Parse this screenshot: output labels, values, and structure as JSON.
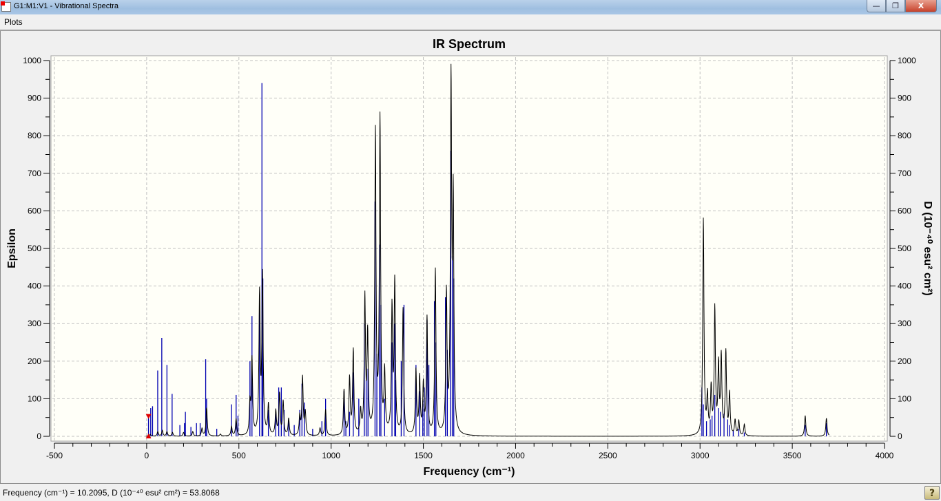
{
  "window": {
    "title": "G1:M1:V1 - Vibrational Spectra",
    "minimize": "—",
    "restore": "❐",
    "close": "X"
  },
  "menu": {
    "items": [
      {
        "label": "Plots"
      }
    ]
  },
  "status": {
    "text": "Frequency (cm⁻¹) = 10.2095, D (10⁻⁴⁰ esu² cm²) = 53.8068",
    "help": "?"
  },
  "colors": {
    "curve": "#000000",
    "sticks": "#0000b0",
    "plot_bg": "#fffff8",
    "grid": "#c0c0c0",
    "marker": "#e00000"
  },
  "chart_data": {
    "type": "line",
    "title": "IR Spectrum",
    "xlabel": "Frequency (cm⁻¹)",
    "ylabel": "Epsilon",
    "y2label": "D (10⁻⁴⁰ esu² cm²)",
    "xlim": [
      -500,
      4000
    ],
    "ylim": [
      0,
      1000
    ],
    "y2lim": [
      0,
      1000
    ],
    "grid": true,
    "xticks": [
      -500,
      0,
      500,
      1000,
      1500,
      2000,
      2500,
      3000,
      3500,
      4000
    ],
    "yticks": [
      0,
      100,
      200,
      300,
      400,
      500,
      600,
      700,
      800,
      900,
      1000
    ],
    "cursor": {
      "frequency": 10.2095,
      "D": 53.8068
    },
    "series": [
      {
        "name": "Epsilon (spectrum)",
        "axis": "left",
        "lineshape_hwhm": 4,
        "peaks": [
          [
            20,
            5
          ],
          [
            60,
            12
          ],
          [
            85,
            15
          ],
          [
            110,
            12
          ],
          [
            140,
            10
          ],
          [
            200,
            10
          ],
          [
            250,
            12
          ],
          [
            300,
            20
          ],
          [
            325,
            75
          ],
          [
            400,
            5
          ],
          [
            460,
            25
          ],
          [
            485,
            45
          ],
          [
            560,
            80
          ],
          [
            571,
            200
          ],
          [
            612,
            370
          ],
          [
            628,
            420
          ],
          [
            660,
            80
          ],
          [
            700,
            65
          ],
          [
            720,
            110
          ],
          [
            740,
            90
          ],
          [
            770,
            45
          ],
          [
            830,
            50
          ],
          [
            845,
            155
          ],
          [
            860,
            60
          ],
          [
            940,
            20
          ],
          [
            970,
            70
          ],
          [
            1070,
            120
          ],
          [
            1100,
            150
          ],
          [
            1120,
            225
          ],
          [
            1160,
            60
          ],
          [
            1183,
            360
          ],
          [
            1198,
            260
          ],
          [
            1240,
            800
          ],
          [
            1265,
            835
          ],
          [
            1290,
            160
          ],
          [
            1330,
            330
          ],
          [
            1345,
            400
          ],
          [
            1390,
            335
          ],
          [
            1460,
            170
          ],
          [
            1480,
            150
          ],
          [
            1500,
            130
          ],
          [
            1520,
            310
          ],
          [
            1565,
            440
          ],
          [
            1625,
            370
          ],
          [
            1650,
            920
          ],
          [
            1662,
            600
          ],
          [
            3018,
            575
          ],
          [
            3040,
            100
          ],
          [
            3060,
            120
          ],
          [
            3080,
            335
          ],
          [
            3100,
            180
          ],
          [
            3115,
            205
          ],
          [
            3140,
            220
          ],
          [
            3160,
            110
          ],
          [
            3190,
            40
          ],
          [
            3210,
            40
          ],
          [
            3240,
            30
          ],
          [
            3570,
            55
          ],
          [
            3685,
            48
          ]
        ]
      },
      {
        "name": "D (sticks)",
        "axis": "right",
        "sticks": [
          [
            10,
            54
          ],
          [
            22,
            75
          ],
          [
            32,
            80
          ],
          [
            60,
            175
          ],
          [
            82,
            262
          ],
          [
            110,
            190
          ],
          [
            138,
            113
          ],
          [
            180,
            30
          ],
          [
            205,
            35
          ],
          [
            210,
            65
          ],
          [
            240,
            25
          ],
          [
            270,
            35
          ],
          [
            290,
            35
          ],
          [
            320,
            205
          ],
          [
            325,
            100
          ],
          [
            380,
            20
          ],
          [
            460,
            85
          ],
          [
            485,
            110
          ],
          [
            495,
            55
          ],
          [
            560,
            200
          ],
          [
            571,
            320
          ],
          [
            612,
            375
          ],
          [
            625,
            940
          ],
          [
            630,
            420
          ],
          [
            660,
            70
          ],
          [
            700,
            60
          ],
          [
            716,
            130
          ],
          [
            730,
            130
          ],
          [
            745,
            70
          ],
          [
            770,
            40
          ],
          [
            800,
            30
          ],
          [
            830,
            70
          ],
          [
            842,
            140
          ],
          [
            855,
            90
          ],
          [
            900,
            20
          ],
          [
            950,
            40
          ],
          [
            970,
            100
          ],
          [
            1070,
            120
          ],
          [
            1080,
            40
          ],
          [
            1100,
            65
          ],
          [
            1120,
            170
          ],
          [
            1150,
            100
          ],
          [
            1180,
            300
          ],
          [
            1190,
            150
          ],
          [
            1200,
            180
          ],
          [
            1238,
            625
          ],
          [
            1248,
            220
          ],
          [
            1262,
            510
          ],
          [
            1270,
            350
          ],
          [
            1290,
            100
          ],
          [
            1330,
            250
          ],
          [
            1345,
            300
          ],
          [
            1350,
            150
          ],
          [
            1380,
            200
          ],
          [
            1395,
            350
          ],
          [
            1460,
            190
          ],
          [
            1480,
            120
          ],
          [
            1497,
            95
          ],
          [
            1505,
            130
          ],
          [
            1520,
            310
          ],
          [
            1530,
            190
          ],
          [
            1560,
            360
          ],
          [
            1568,
            250
          ],
          [
            1620,
            370
          ],
          [
            1630,
            230
          ],
          [
            1648,
            760
          ],
          [
            1657,
            480
          ],
          [
            1665,
            420
          ],
          [
            3010,
            130
          ],
          [
            3018,
            85
          ],
          [
            3035,
            40
          ],
          [
            3055,
            45
          ],
          [
            3065,
            55
          ],
          [
            3080,
            110
          ],
          [
            3100,
            75
          ],
          [
            3110,
            65
          ],
          [
            3130,
            60
          ],
          [
            3150,
            45
          ],
          [
            3160,
            30
          ],
          [
            3180,
            15
          ],
          [
            3210,
            20
          ],
          [
            3240,
            10
          ],
          [
            3570,
            30
          ],
          [
            3685,
            35
          ]
        ]
      }
    ]
  }
}
